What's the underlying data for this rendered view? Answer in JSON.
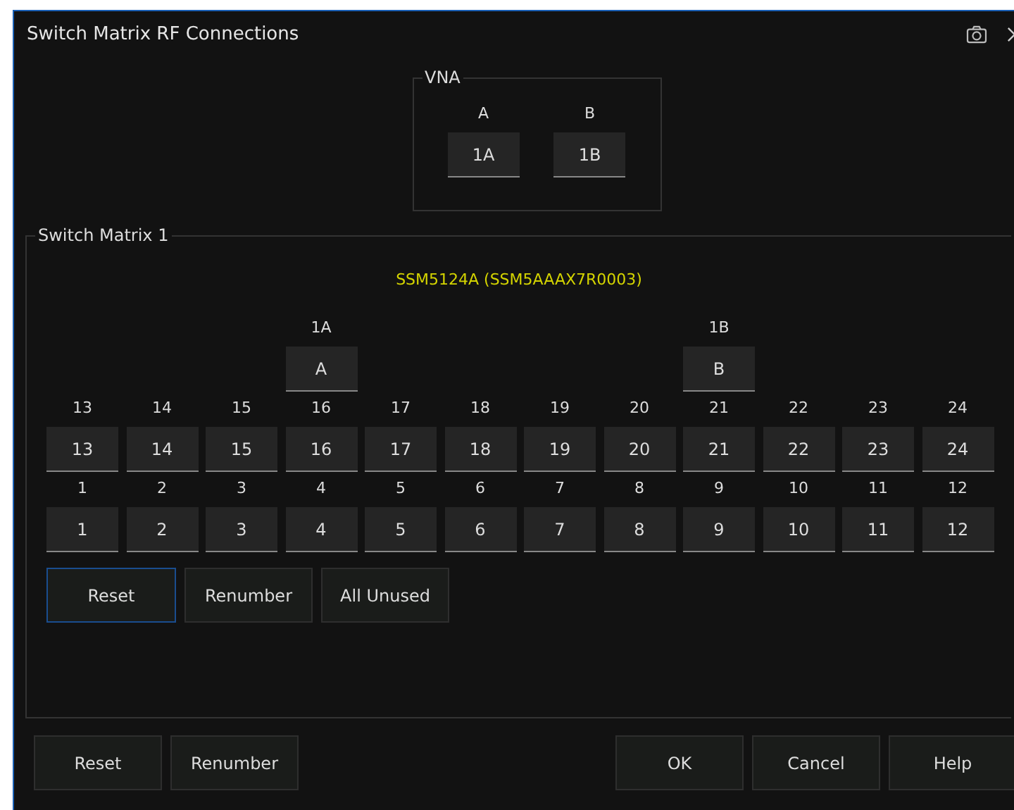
{
  "window": {
    "title": "Switch Matrix RF Connections"
  },
  "vna": {
    "title": "VNA",
    "ports": [
      {
        "label": "A",
        "button": "1A"
      },
      {
        "label": "B",
        "button": "1B"
      }
    ]
  },
  "switch_matrix": {
    "title": "Switch Matrix 1",
    "model": "SSM5124A (SSM5AAAX7R0003)",
    "rows": [
      {
        "ports": [
          {
            "label": "13",
            "button": "13"
          },
          {
            "label": "14",
            "button": "14"
          },
          {
            "label": "15",
            "button": "15"
          },
          {
            "label": "16",
            "button": "16",
            "vna_link": {
              "label": "1A",
              "button": "A"
            }
          },
          {
            "label": "17",
            "button": "17"
          },
          {
            "label": "18",
            "button": "18"
          },
          {
            "label": "19",
            "button": "19"
          },
          {
            "label": "20",
            "button": "20"
          },
          {
            "label": "21",
            "button": "21",
            "vna_link": {
              "label": "1B",
              "button": "B"
            }
          },
          {
            "label": "22",
            "button": "22"
          },
          {
            "label": "23",
            "button": "23"
          },
          {
            "label": "24",
            "button": "24"
          }
        ]
      },
      {
        "ports": [
          {
            "label": "1",
            "button": "1"
          },
          {
            "label": "2",
            "button": "2"
          },
          {
            "label": "3",
            "button": "3"
          },
          {
            "label": "4",
            "button": "4"
          },
          {
            "label": "5",
            "button": "5"
          },
          {
            "label": "6",
            "button": "6"
          },
          {
            "label": "7",
            "button": "7"
          },
          {
            "label": "8",
            "button": "8"
          },
          {
            "label": "9",
            "button": "9"
          },
          {
            "label": "10",
            "button": "10"
          },
          {
            "label": "11",
            "button": "11"
          },
          {
            "label": "12",
            "button": "12"
          }
        ]
      }
    ],
    "buttons": [
      {
        "label": "Reset",
        "focused": true
      },
      {
        "label": "Renumber",
        "focused": false
      },
      {
        "label": "All Unused",
        "focused": false
      }
    ]
  },
  "footer": {
    "left_buttons": [
      "Reset",
      "Renumber"
    ],
    "right_buttons": [
      "OK",
      "Cancel",
      "Help"
    ]
  }
}
